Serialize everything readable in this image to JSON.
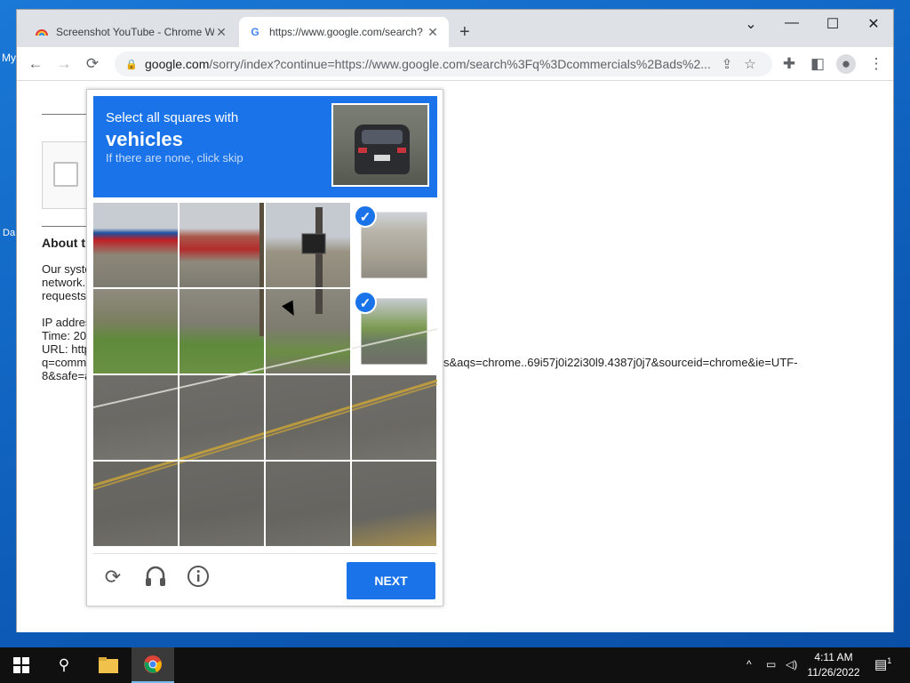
{
  "desktop": {
    "label_my": "My",
    "label_da": "Da"
  },
  "tabs": [
    {
      "title": "Screenshot YouTube - Chrome W",
      "favicon": "rainbow-icon"
    },
    {
      "title": "https://www.google.com/search?",
      "favicon": "google-g-icon",
      "favicon_glyph": "G"
    }
  ],
  "toolbar": {
    "url_host": "google.com",
    "url_rest": "/sorry/index?continue=https://www.google.com/search%3Fq%3Dcommercials%2Bads%2...",
    "back": "←",
    "forward": "→",
    "reload": "⟳"
  },
  "page": {
    "about_heading": "About th",
    "para_l1": "Our syste",
    "para_l2": "network.",
    "para_l3": "requests",
    "ip_label": "IP addres",
    "time_label": "Time: 20",
    "url_label": "URL: http",
    "url_cont1": "q=comm",
    "url_tail": "s&aqs=chrome..69i57j0i22i30l9.4387j0j7&sourceid=chrome&ie=UTF-",
    "url_cont2": "8&safe=a"
  },
  "captcha": {
    "instruction": "Select all squares with",
    "target": "vehicles",
    "hint": "If there are none, click skip",
    "next_label": "NEXT",
    "check_glyph": "✓",
    "selected_cells": [
      3,
      7
    ]
  },
  "taskbar": {
    "time": "4:11 AM",
    "date": "11/26/2022",
    "notif_count": "1"
  },
  "colors": {
    "accent": "#1a73e8",
    "taskbar": "#101010"
  }
}
